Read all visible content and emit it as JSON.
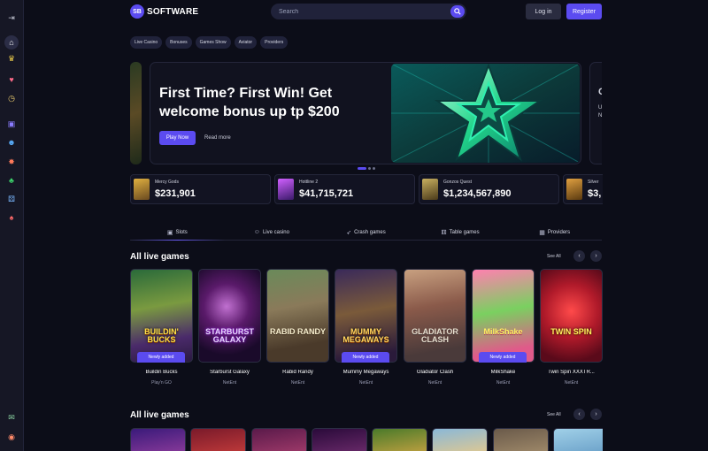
{
  "brand": {
    "mark": "SB",
    "name": "SOFTWARE",
    "accent": "#5b4bf0"
  },
  "search": {
    "placeholder": "Search"
  },
  "auth": {
    "login": "Log in",
    "register": "Register"
  },
  "categories": [
    "Live Casino",
    "Bonuses",
    "Games Show",
    "Aviator",
    "Providers"
  ],
  "sidebar_icons": [
    "logout-icon",
    "home-icon",
    "trophy-icon",
    "heart-icon",
    "clock-icon",
    "slots-icon",
    "live-dealer-icon",
    "crash-icon",
    "clover-icon",
    "table-games-icon",
    "cards-icon",
    "chat-icon",
    "language-icon"
  ],
  "hero": {
    "title": "First Time? First Win! Get welcome bonus up tp $200",
    "play": "Play Now",
    "more": "Read more",
    "next_peek": [
      "U",
      "N"
    ],
    "next_peek_title": "C"
  },
  "jackpots": [
    {
      "name": "Mercy Gods",
      "amount": "$231,901"
    },
    {
      "name": "Hottline 2",
      "amount": "$41,715,721"
    },
    {
      "name": "Gonzos Quest",
      "amount": "$1,234,567,890"
    },
    {
      "name": "Silver",
      "amount": "$3,"
    }
  ],
  "tabs": [
    {
      "label": "Slots",
      "icon": "slots-icon"
    },
    {
      "label": "Live casino",
      "icon": "user-icon"
    },
    {
      "label": "Crash games",
      "icon": "rocket-icon"
    },
    {
      "label": "Table games",
      "icon": "dice-icon"
    },
    {
      "label": "Providers",
      "icon": "grid-icon"
    }
  ],
  "section1": {
    "title": "All live games",
    "see_all": "See All"
  },
  "section2": {
    "title": "All live games",
    "see_all": "See All"
  },
  "badge": "Newly added",
  "games": [
    {
      "name": "Buildin Bucks",
      "provider": "Play'n GO",
      "art": "BUILDIN' BUCKS",
      "badge": true
    },
    {
      "name": "Starburst Galaxy",
      "provider": "NetEnt",
      "art": "STARBURST GALAXY",
      "badge": false
    },
    {
      "name": "Rabid Randy",
      "provider": "NetEnt",
      "art": "RABID RANDY",
      "badge": false
    },
    {
      "name": "Mummy Megaways",
      "provider": "NetEnt",
      "art": "MUMMY MEGAWAYS",
      "badge": true
    },
    {
      "name": "Gladiator Clash",
      "provider": "NetEnt",
      "art": "GLADIATOR CLASH",
      "badge": false
    },
    {
      "name": "MilkShake",
      "provider": "NetEnt",
      "art": "MilkShake",
      "badge": true
    },
    {
      "name": "Twin Spin XXXTR...",
      "provider": "NetEnt",
      "art": "TWIN SPIN",
      "badge": false
    }
  ]
}
